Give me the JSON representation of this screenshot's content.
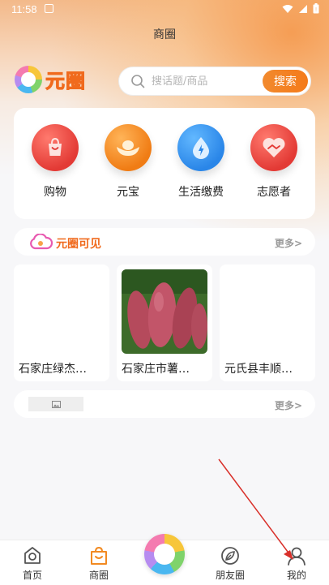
{
  "status_bar": {
    "time": "11:58",
    "icons": [
      "notification-icon",
      "wifi-icon",
      "signal-icon",
      "battery-icon"
    ]
  },
  "header": {
    "title": "商圈"
  },
  "brand": {
    "name": "元圈"
  },
  "search": {
    "placeholder": "搜话题/商品",
    "value": "",
    "button_label": "搜索"
  },
  "services": [
    {
      "label": "购物",
      "icon": "shopping-bag-icon",
      "color": "#e8403b"
    },
    {
      "label": "元宝",
      "icon": "ingot-icon",
      "color": "#f28a22"
    },
    {
      "label": "生活缴费",
      "icon": "water-drop-icon",
      "color": "#2f93ef"
    },
    {
      "label": "志愿者",
      "icon": "handshake-heart-icon",
      "color": "#e8403b"
    }
  ],
  "section_visible": {
    "title": "元圈可见",
    "more": "更多>"
  },
  "products": [
    {
      "name": "石家庄绿杰…",
      "has_image": false
    },
    {
      "name": "石家庄市薯…",
      "has_image": true,
      "image": "sweet-potato-photo"
    },
    {
      "name": "元氏县丰顺…",
      "has_image": false
    }
  ],
  "section_second": {
    "more": "更多>"
  },
  "bottom_nav": [
    {
      "label": "首页",
      "icon": "home-icon"
    },
    {
      "label": "商圈",
      "icon": "shop-bag-icon",
      "active": true
    },
    {
      "label": "",
      "icon": "yuanquan-logo-icon"
    },
    {
      "label": "朋友圈",
      "icon": "leaf-circle-icon"
    },
    {
      "label": "我的",
      "icon": "user-icon"
    }
  ],
  "colors": {
    "accent": "#f06a1d",
    "active_nav": "#f28a22",
    "annotation_arrow": "#d9302a"
  }
}
